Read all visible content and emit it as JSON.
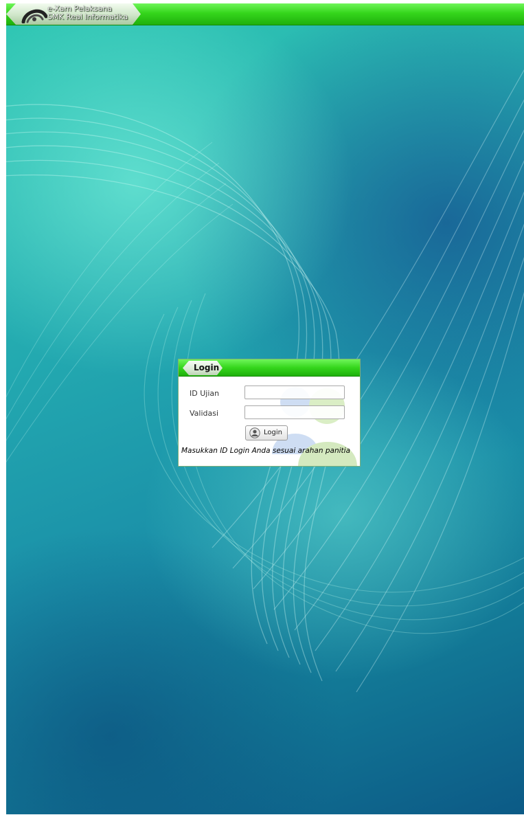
{
  "header": {
    "line1": "e-Xam Pelaksana",
    "line2": "SMK Real Informatika",
    "logo_icon": "exam-logo-icon"
  },
  "login": {
    "tab_label": "Login",
    "id_label": "ID Ujian",
    "id_value": "",
    "validation_label": "Validasi",
    "validation_value": "",
    "button_label": "Login",
    "button_icon": "user-icon",
    "note": "Masukkan ID Login Anda sesuai arahan panitia"
  },
  "colors": {
    "bar_green": "#35d61c",
    "bg_teal": "#23a9b0",
    "bg_navy": "#0c5a86"
  }
}
